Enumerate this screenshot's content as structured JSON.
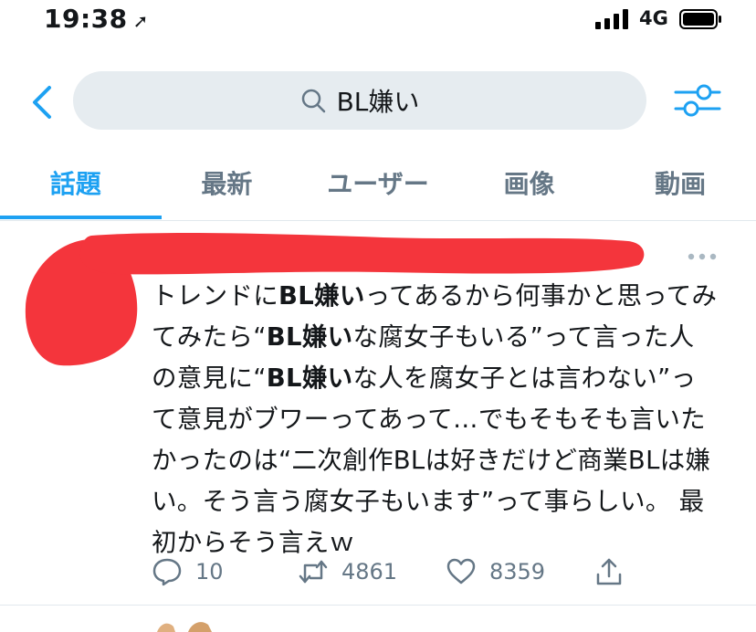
{
  "status_bar": {
    "time": "19:38",
    "location_glyph": "➚",
    "network": "4G"
  },
  "search": {
    "query": "BL嫌い"
  },
  "tabs": [
    {
      "label": "話題",
      "active": true
    },
    {
      "label": "最新",
      "active": false
    },
    {
      "label": "ユーザー",
      "active": false
    },
    {
      "label": "画像",
      "active": false
    },
    {
      "label": "動画",
      "active": false
    }
  ],
  "tweet": {
    "text_parts": [
      {
        "text": "トレンドに",
        "bold": false
      },
      {
        "text": "BL嫌い",
        "bold": true
      },
      {
        "text": "ってあるから何事かと思ってみてみたら“",
        "bold": false
      },
      {
        "text": "BL嫌い",
        "bold": true
      },
      {
        "text": "な腐女子もいる”って言った人の意見に“",
        "bold": false
      },
      {
        "text": "BL嫌い",
        "bold": true
      },
      {
        "text": "な人を腐女子とは言わない”って意見がブワーってあって…でもそもそも言いたかったのは“二次創作BLは好きだけど商業BLは嫌い。そう言う腐女子もいます”って事らしい。 最初からそう言えｗ",
        "bold": false
      }
    ],
    "replies": "10",
    "retweets": "4861",
    "likes": "8359"
  },
  "colors": {
    "accent": "#1da1f2",
    "muted": "#657786",
    "search_bg": "#e6ecf0",
    "redaction": "#f4353c"
  }
}
